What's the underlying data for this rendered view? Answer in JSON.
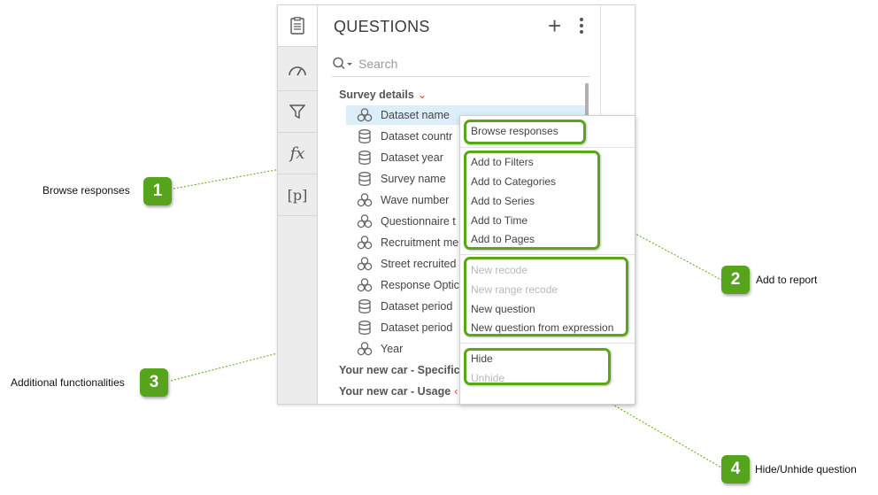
{
  "panel": {
    "title": "QUESTIONS",
    "search_placeholder": "Search"
  },
  "rail": {
    "items": [
      "questions-list-icon",
      "gauge-icon",
      "filter-icon",
      "fx",
      "[p]"
    ]
  },
  "groups": [
    {
      "label": "Survey details"
    },
    {
      "label": "Your new car - Specifica"
    },
    {
      "label": "Your new car - Usage"
    }
  ],
  "questions": [
    {
      "label": "Dataset name",
      "icon": "category-icon"
    },
    {
      "label": "Dataset countr",
      "icon": "database-icon"
    },
    {
      "label": "Dataset year",
      "icon": "database-icon"
    },
    {
      "label": "Survey name",
      "icon": "database-icon"
    },
    {
      "label": "Wave number",
      "icon": "category-icon"
    },
    {
      "label": "Questionnaire t",
      "icon": "category-icon"
    },
    {
      "label": "Recruitment me",
      "icon": "category-icon"
    },
    {
      "label": "Street recruited",
      "icon": "category-icon"
    },
    {
      "label": "Response Optic",
      "icon": "category-icon"
    },
    {
      "label": "Dataset period",
      "icon": "database-icon"
    },
    {
      "label": "Dataset period",
      "icon": "database-icon"
    },
    {
      "label": "Year",
      "icon": "category-icon"
    }
  ],
  "menu": {
    "browse": "Browse responses",
    "add_filters": "Add to Filters",
    "add_categories": "Add to Categories",
    "add_series": "Add to Series",
    "add_time": "Add to Time",
    "add_pages": "Add to Pages",
    "new_recode": "New recode",
    "new_range_recode": "New range recode",
    "new_question": "New question",
    "new_question_expr": "New question from expression",
    "hide": "Hide",
    "unhide": "Unhide"
  },
  "callouts": [
    {
      "number": "1",
      "label": "Browse responses"
    },
    {
      "number": "2",
      "label": "Add to report"
    },
    {
      "number": "3",
      "label": "Additional functionalities"
    },
    {
      "number": "4",
      "label": "Hide/Unhide question"
    }
  ],
  "colors": {
    "accent_green": "#56a31c",
    "selection": "#ddeefb",
    "chevron": "#e0453c"
  }
}
